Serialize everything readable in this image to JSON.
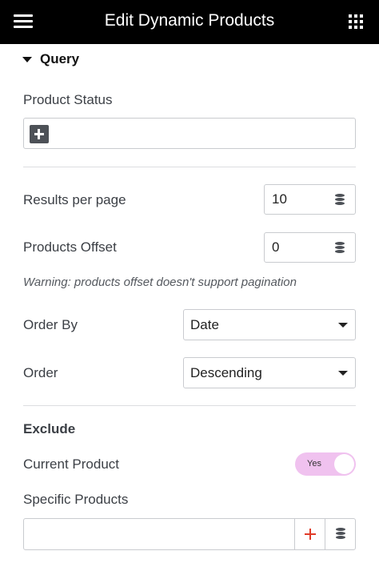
{
  "header": {
    "title": "Edit Dynamic Products",
    "menu_icon": "hamburger-menu-icon",
    "apps_icon": "grid-apps-icon",
    "background": "#000000"
  },
  "section": {
    "title": "Query",
    "expanded": true
  },
  "product_status": {
    "label": "Product Status",
    "add_icon": "plus-icon"
  },
  "results_per_page": {
    "label": "Results per page",
    "value": "10",
    "dynamic_icon": "database-icon"
  },
  "products_offset": {
    "label": "Products Offset",
    "value": "0",
    "dynamic_icon": "database-icon",
    "warning": "Warning: products offset doesn't support pagination"
  },
  "order_by": {
    "label": "Order By",
    "selected": "Date"
  },
  "order": {
    "label": "Order",
    "selected": "Descending"
  },
  "exclude": {
    "heading": "Exclude",
    "current_product": {
      "label": "Current Product",
      "toggle_text": "Yes",
      "on": true,
      "toggle_color": "#f0c2ef"
    },
    "specific_products": {
      "label": "Specific Products",
      "value": "",
      "add_icon": "plus-icon",
      "add_icon_color": "#e03b28",
      "dynamic_icon": "database-icon"
    }
  }
}
